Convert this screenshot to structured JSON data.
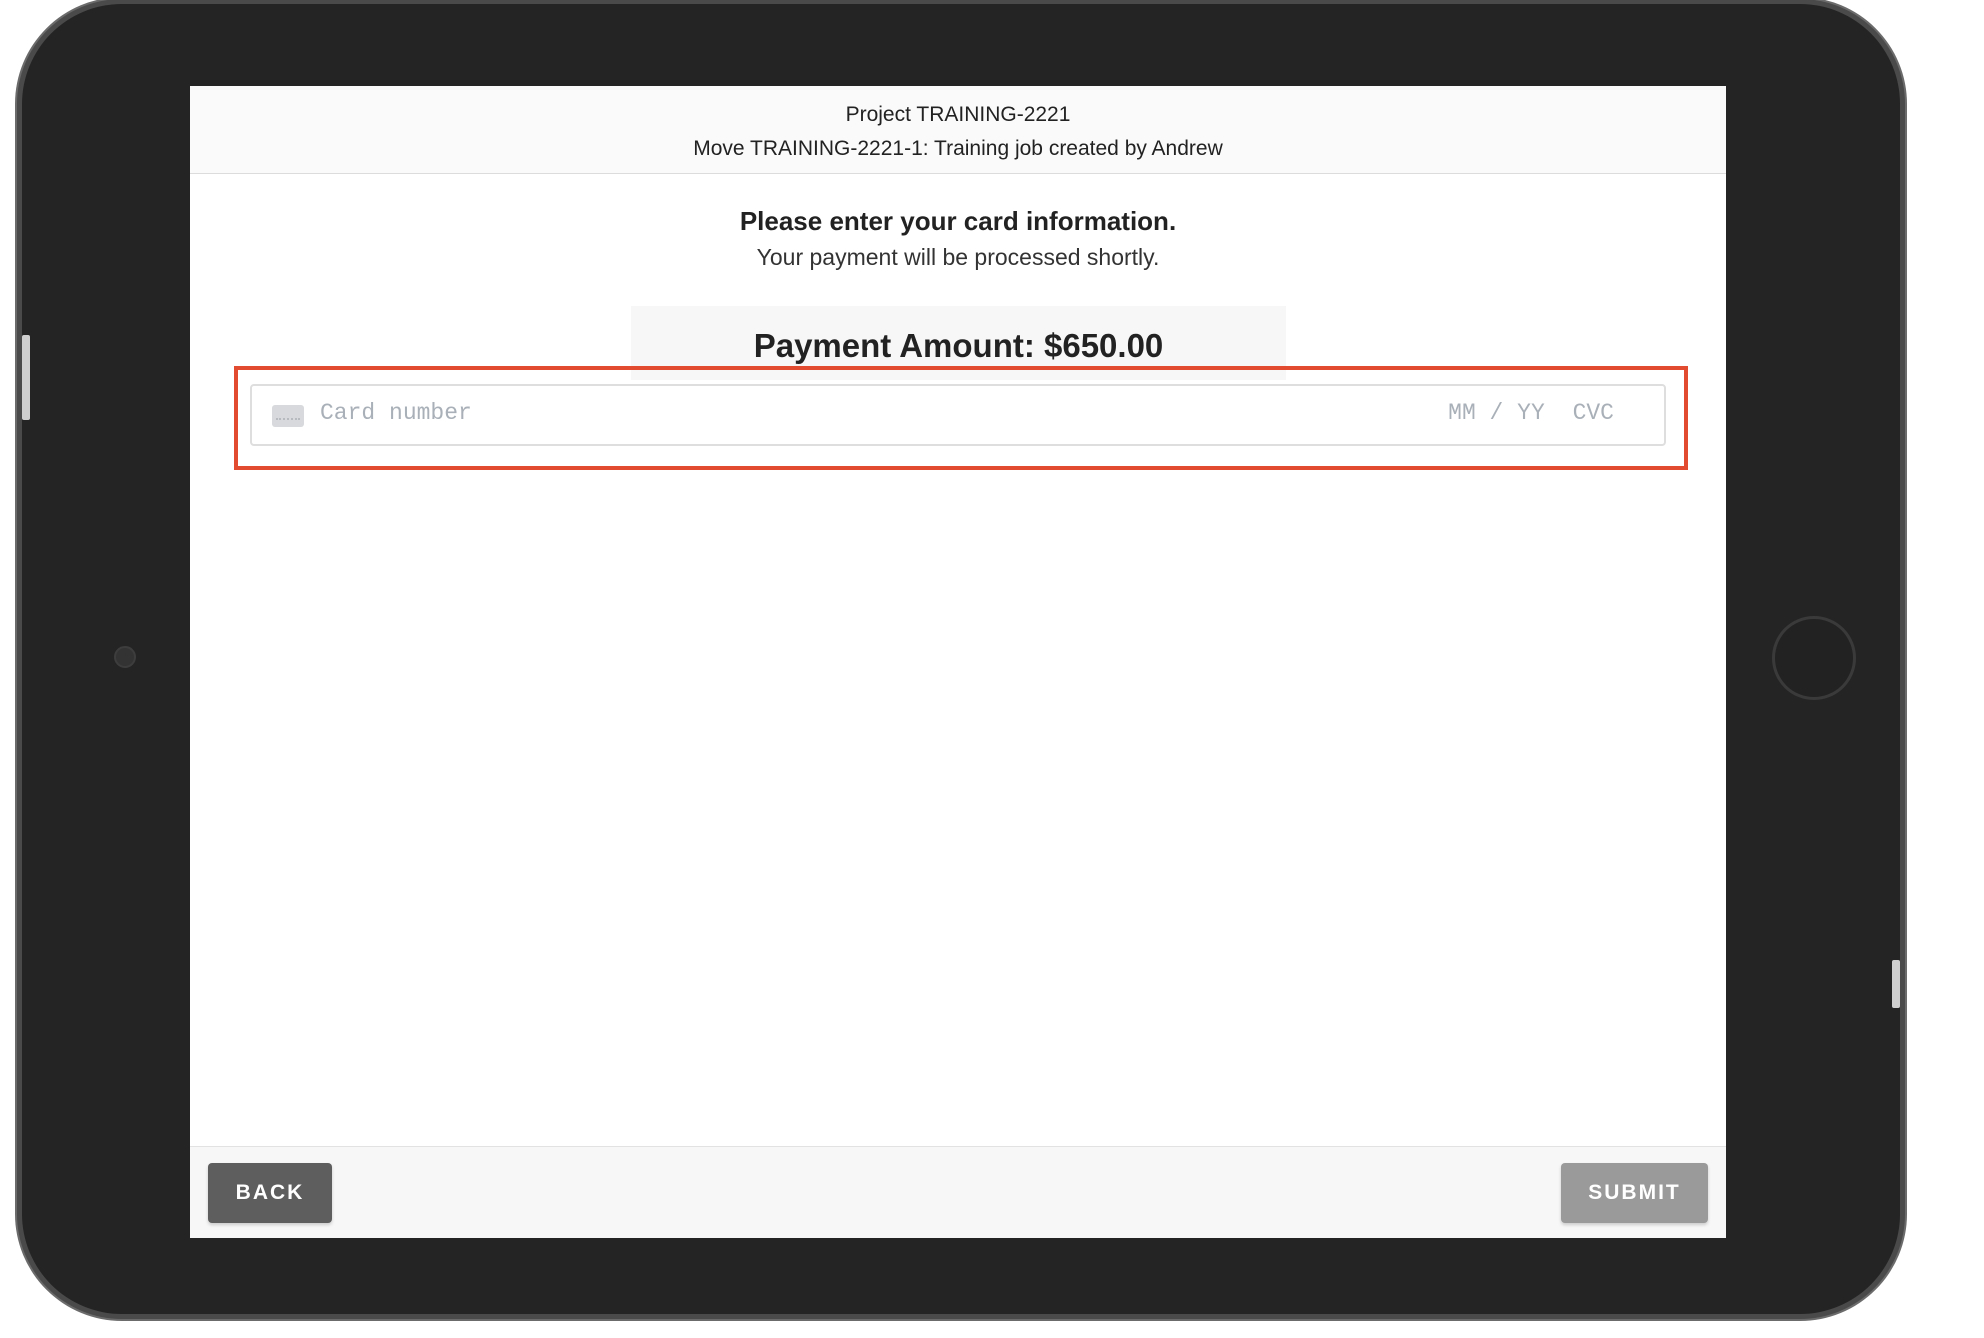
{
  "header": {
    "project": "Project TRAINING-2221",
    "move": "Move TRAINING-2221-1: Training job created by Andrew"
  },
  "prompt": {
    "title": "Please enter your card information.",
    "subtitle": "Your payment will be processed shortly."
  },
  "payment": {
    "amount_label": "Payment Amount: $650.00"
  },
  "card_field": {
    "number_placeholder": "Card number",
    "expiry_placeholder": "MM / YY",
    "cvc_placeholder": "CVC",
    "icon": "credit-card-icon"
  },
  "footer": {
    "back_label": "BACK",
    "submit_label": "SUBMIT"
  },
  "colors": {
    "highlight": "#e24b2f",
    "back_button": "#5e5e5e",
    "submit_button": "#9a9a9a",
    "device_frame": "#242424"
  }
}
